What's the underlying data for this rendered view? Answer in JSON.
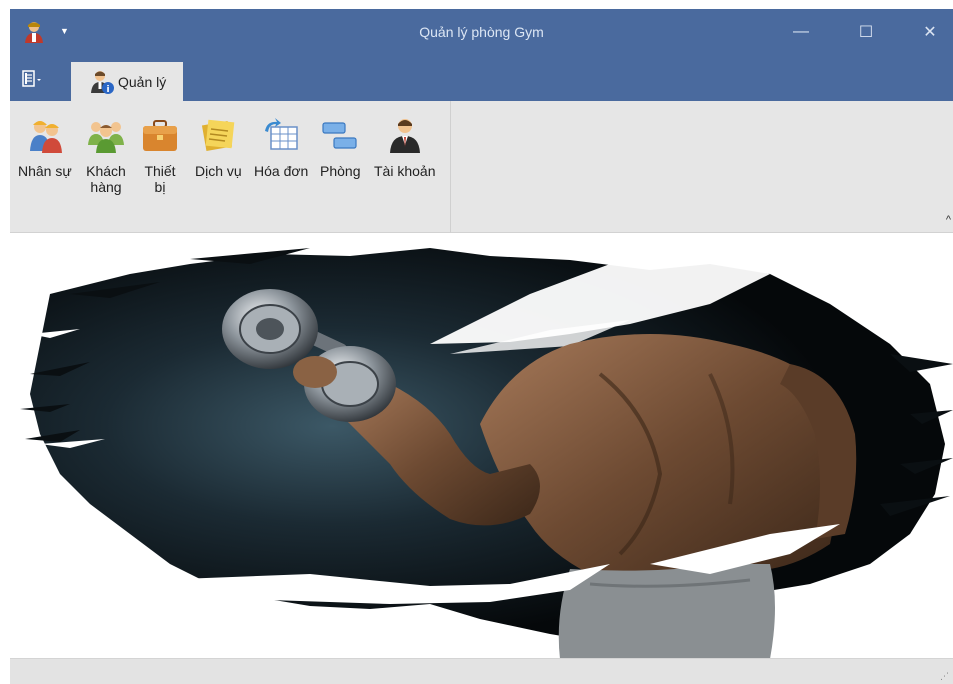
{
  "window": {
    "title": "Quản lý phòng Gym",
    "controls": {
      "minimize": "—",
      "maximize": "☐",
      "close": "✕"
    }
  },
  "tabs": [
    {
      "label": "Quản lý",
      "icon": "user-info-icon",
      "active": true
    }
  ],
  "ribbon": {
    "buttons": [
      {
        "label": "Nhân sự",
        "icon": "staff-workers-icon"
      },
      {
        "label": "Khách\nhàng",
        "icon": "customers-group-icon"
      },
      {
        "label": "Thiết\nbị",
        "icon": "equipment-briefcase-icon"
      },
      {
        "label": "Dịch vụ",
        "icon": "service-notes-icon"
      },
      {
        "label": "Hóa đơn",
        "icon": "invoice-table-icon"
      },
      {
        "label": "Phòng",
        "icon": "room-blocks-icon"
      },
      {
        "label": "Tài khoản",
        "icon": "account-businessman-icon"
      }
    ],
    "collapse_glyph": "^"
  },
  "colors": {
    "titlebar": "#4a6a9e",
    "ribbon": "#e6e6e6",
    "statusbar": "#e3e3e3"
  },
  "content": {
    "image": "gym-bodybuilder-dumbbell-picture"
  }
}
